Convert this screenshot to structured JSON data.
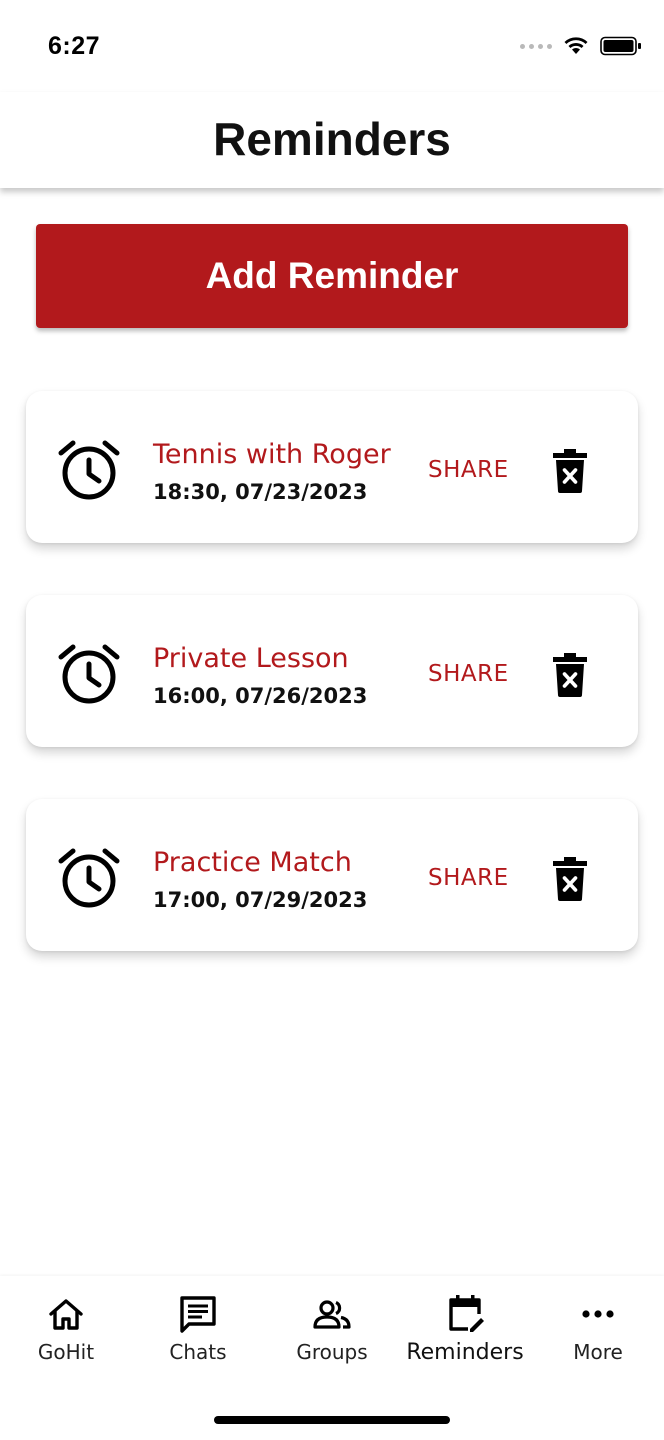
{
  "status_bar": {
    "time": "6:27"
  },
  "header": {
    "title": "Reminders"
  },
  "add_button": {
    "label": "Add Reminder"
  },
  "colors": {
    "accent": "#b2191c",
    "text": "#111111"
  },
  "reminders": [
    {
      "title": "Tennis with Roger",
      "datetime": "18:30, 07/23/2023",
      "share_label": "SHARE"
    },
    {
      "title": "Private Lesson",
      "datetime": "16:00, 07/26/2023",
      "share_label": "SHARE"
    },
    {
      "title": "Practice Match",
      "datetime": "17:00, 07/29/2023",
      "share_label": "SHARE"
    }
  ],
  "tabs": [
    {
      "label": "GoHit",
      "icon": "home-icon"
    },
    {
      "label": "Chats",
      "icon": "chat-icon"
    },
    {
      "label": "Groups",
      "icon": "groups-icon"
    },
    {
      "label": "Reminders",
      "icon": "calendar-edit-icon",
      "active": true
    },
    {
      "label": "More",
      "icon": "more-icon"
    }
  ]
}
